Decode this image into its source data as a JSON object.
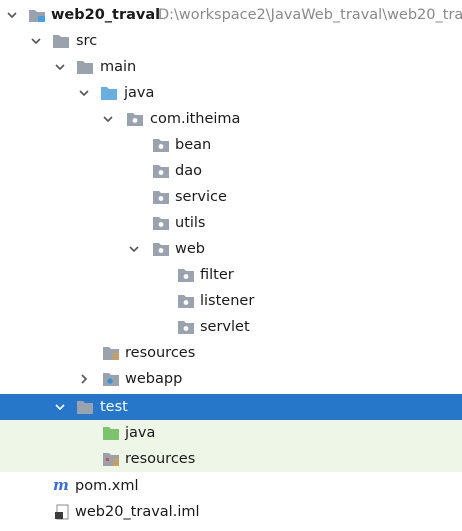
{
  "project": {
    "name": "web20_traval",
    "path": "D:\\workspace2\\JavaWeb_traval\\web20_tra"
  },
  "tree": [
    {
      "label": "src"
    },
    {
      "label": "main"
    },
    {
      "label": "java"
    },
    {
      "label": "com.itheima"
    },
    {
      "label": "bean"
    },
    {
      "label": "dao"
    },
    {
      "label": "service"
    },
    {
      "label": "utils"
    },
    {
      "label": "web"
    },
    {
      "label": "filter"
    },
    {
      "label": "listener"
    },
    {
      "label": "servlet"
    },
    {
      "label": "resources"
    },
    {
      "label": "webapp"
    },
    {
      "label": "test"
    },
    {
      "label": "java"
    },
    {
      "label": "resources"
    },
    {
      "label": "pom.xml"
    },
    {
      "label": "web20_traval.iml"
    }
  ],
  "colors": {
    "selection": "#2676c9",
    "test_background": "#eef7e7",
    "folder": "#9aa3ad",
    "source_folder": "#6aaee0",
    "test_folder": "#7cc46c",
    "maven_icon": "#3b6fd8"
  }
}
